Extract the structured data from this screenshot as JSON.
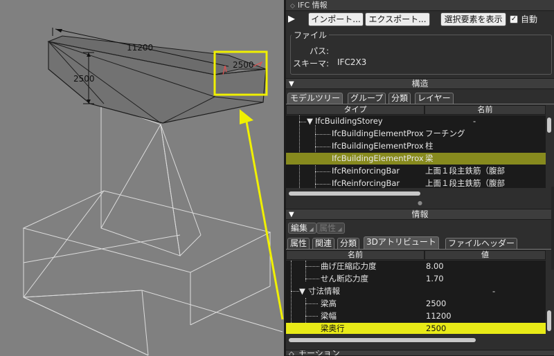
{
  "viewport": {
    "dim_width": "11200",
    "dim_height": "2500",
    "dim_depth": "2500"
  },
  "panel": {
    "title": "IFC 情報",
    "toolbar": {
      "import_label": "インポート...",
      "export_label": "エクスポート...",
      "show_selection_label": "選択要素を表示",
      "auto_label": "自動",
      "auto_checked": true
    },
    "file": {
      "legend": "ファイル",
      "path_label": "パス:",
      "path_value": "",
      "schema_label": "スキーマ:",
      "schema_value": "IFC2X3"
    },
    "structure": {
      "title": "構造",
      "tabs": [
        "モデルツリー",
        "グループ",
        "分類",
        "レイヤー"
      ],
      "columns": [
        "タイプ",
        "名前"
      ],
      "rows": [
        {
          "type": "IfcBuildingStorey",
          "name": "-",
          "selected": false
        },
        {
          "type": "IfcBuildingElementProx",
          "name": "フーチング",
          "selected": false
        },
        {
          "type": "IfcBuildingElementProx",
          "name": "柱",
          "selected": false
        },
        {
          "type": "IfcBuildingElementProx",
          "name": "梁",
          "selected": true
        },
        {
          "type": "IfcReinforcingBar",
          "name": "上面１段主鉄筋（腹部",
          "selected": false
        },
        {
          "type": "IfcReinforcingBar",
          "name": "上面１段主鉄筋（腹部",
          "selected": false
        }
      ]
    },
    "info": {
      "title": "情報",
      "edit_label": "編集",
      "attr_label": "属性",
      "tabs": [
        "属性",
        "関連",
        "分類",
        "3Dアトリビュート",
        "ファイルヘッダー"
      ],
      "columns": [
        "名前",
        "値"
      ],
      "rows": [
        {
          "name": "曲げ圧縮応力度",
          "value": "8.00",
          "selected": false
        },
        {
          "name": "せん断応力度",
          "value": "1.70",
          "selected": false
        },
        {
          "name": "寸法情報",
          "value": "-",
          "selected": false
        },
        {
          "name": "梁高",
          "value": "2500",
          "selected": false
        },
        {
          "name": "梁幅",
          "value": "11200",
          "selected": false
        },
        {
          "name": "梁奥行",
          "value": "2500",
          "selected": true
        }
      ]
    },
    "bottom_section_title": "モーション"
  },
  "colors": {
    "highlight_olive": "#878a1e",
    "highlight_yellow": "#e8ea17",
    "annotation_yellow": "#f0f000",
    "dimension_red": "#e05050"
  }
}
